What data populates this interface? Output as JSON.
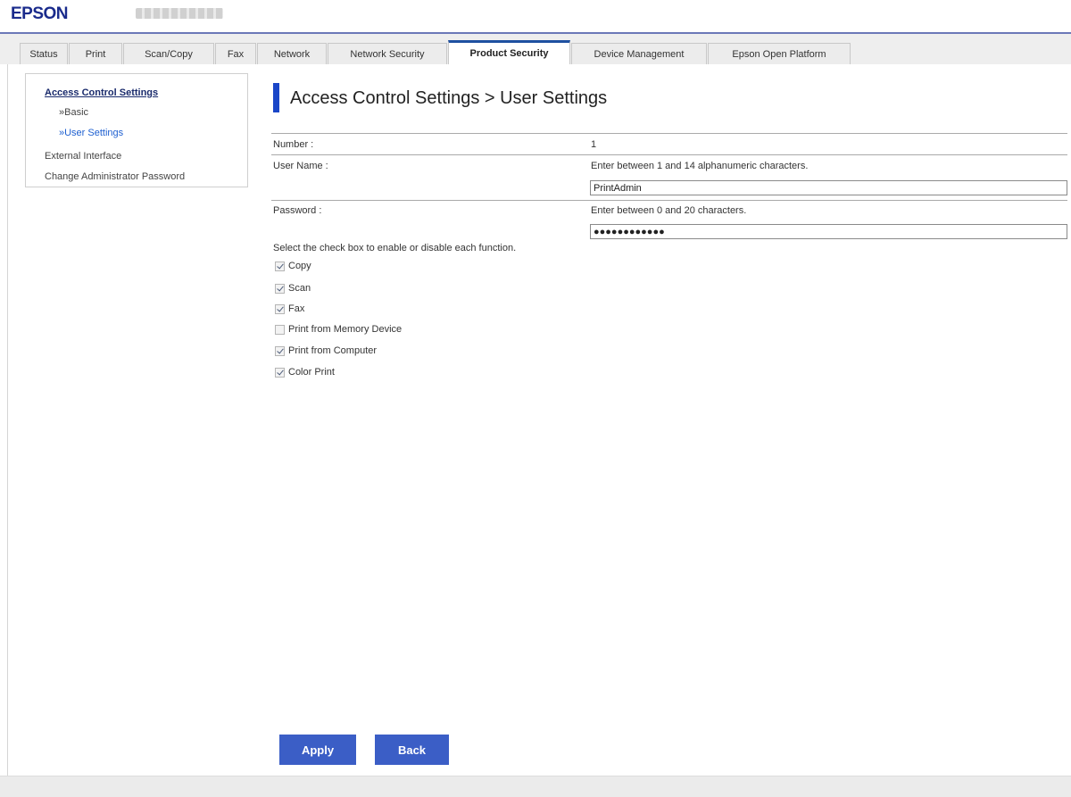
{
  "header": {
    "brand": "EPSON"
  },
  "tabs": [
    {
      "label": "Status"
    },
    {
      "label": "Print"
    },
    {
      "label": "Scan/Copy"
    },
    {
      "label": "Fax"
    },
    {
      "label": "Network"
    },
    {
      "label": "Network Security"
    },
    {
      "label": "Product Security",
      "active": true
    },
    {
      "label": "Device Management"
    },
    {
      "label": "Epson Open Platform"
    }
  ],
  "sidebar": {
    "items": [
      {
        "label": "Access Control Settings"
      },
      {
        "label": "»Basic"
      },
      {
        "label": "»User Settings"
      },
      {
        "label": "External Interface"
      },
      {
        "label": "Change Administrator Password"
      }
    ]
  },
  "page": {
    "title": "Access Control Settings > User Settings"
  },
  "form": {
    "number_label": "Number :",
    "number_value": "1",
    "username_label": "User Name :",
    "username_hint": "Enter between 1 and 14 alphanumeric characters.",
    "username_value": "PrintAdmin",
    "password_label": "Password :",
    "password_hint": "Enter between 0 and 20 characters.",
    "password_value": "●●●●●●●●●●●●",
    "instruction": "Select the check box to enable or disable each function.",
    "functions": [
      {
        "label": "Copy",
        "checked": true
      },
      {
        "label": "Scan",
        "checked": true
      },
      {
        "label": "Fax",
        "checked": true
      },
      {
        "label": "Print from Memory Device",
        "checked": false
      },
      {
        "label": "Print from Computer",
        "checked": true
      },
      {
        "label": "Color Print",
        "checked": true
      }
    ]
  },
  "buttons": {
    "apply": "Apply",
    "back": "Back"
  },
  "colors": {
    "brand": "#1a2b8c",
    "accent": "#1a46c8",
    "button": "#3b5ec6",
    "link_active": "#1d5fd0"
  }
}
